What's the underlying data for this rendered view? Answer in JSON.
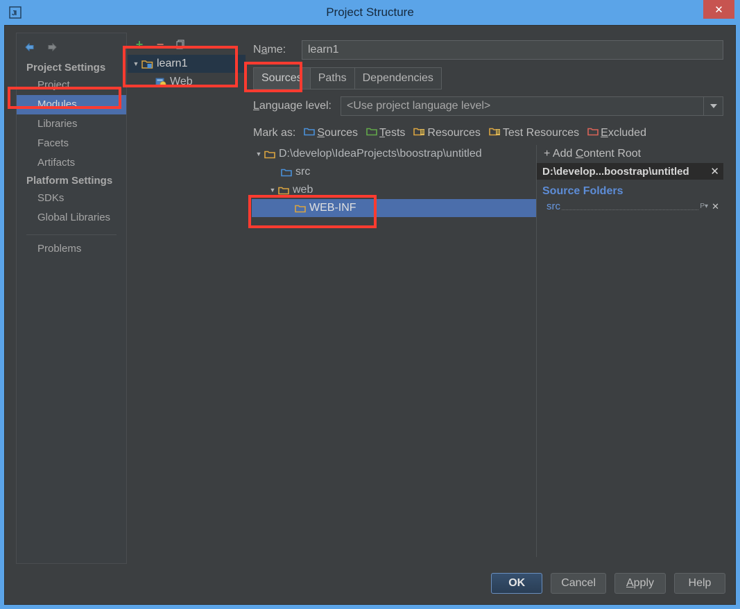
{
  "window": {
    "title": "Project Structure",
    "app_icon": "intellij-idea-icon",
    "close_label": "✕",
    "titlebar_color": "#5BA4E8",
    "close_color": "#C75450"
  },
  "sidebar": {
    "back_label": "◀",
    "forward_label": "▶",
    "groups": [
      {
        "header": "Project Settings",
        "items": [
          "Project",
          "Modules",
          "Libraries",
          "Facets",
          "Artifacts"
        ]
      },
      {
        "header": "Platform Settings",
        "items": [
          "SDKs",
          "Global Libraries"
        ]
      }
    ],
    "extra": [
      "Problems"
    ],
    "selected": "Modules",
    "selection_color": "#4B6EAB"
  },
  "module_panel": {
    "toolbar": {
      "add_label": "+",
      "remove_label": "−",
      "copy_label": "⧉"
    },
    "tree": [
      {
        "label": "learn1",
        "icon": "module-folder-icon",
        "twisty": "▼",
        "indent": 0,
        "selected": true
      },
      {
        "label": "Web",
        "icon": "web-facet-icon",
        "twisty": "",
        "indent": 1,
        "selected": false
      }
    ]
  },
  "main": {
    "name_label": "Name:",
    "name_value": "learn1",
    "tabs": [
      {
        "label": "Sources",
        "active": true
      },
      {
        "label": "Paths",
        "active": false
      },
      {
        "label": "Dependencies",
        "active": false
      }
    ],
    "language_level_label": "Language level:",
    "language_level_value": "<Use project language level>",
    "language_level_arrow": "▼",
    "mark_as_label": "Mark as:",
    "mark_as": [
      {
        "label": "Sources",
        "color": "#4A90D9",
        "icon": "folder-sources-icon"
      },
      {
        "label": "Tests",
        "color": "#62A84A",
        "icon": "folder-tests-icon"
      },
      {
        "label": "Resources",
        "color": "#D9A441",
        "icon": "folder-resources-icon"
      },
      {
        "label": "Test Resources",
        "color": "#D9A441",
        "icon": "folder-test-resources-icon"
      },
      {
        "label": "Excluded",
        "color": "#D96459",
        "icon": "folder-excluded-icon"
      }
    ],
    "tree": [
      {
        "label": "D:\\develop\\IdeaProjects\\boostrap\\untitled",
        "twisty": "▼",
        "indent": 0,
        "color": "#D9A441",
        "selected": false
      },
      {
        "label": "src",
        "twisty": "",
        "indent": 1,
        "color": "#4A90D9",
        "selected": false
      },
      {
        "label": "web",
        "twisty": "▼",
        "indent": 1,
        "color": "#D9A441",
        "selected": false
      },
      {
        "label": "WEB-INF",
        "twisty": "",
        "indent": 2,
        "color": "#D9A441",
        "selected": true
      }
    ],
    "right_panel": {
      "add_content_root": "+ Add Content Root",
      "content_root": "D:\\develop...boostrap\\untitled",
      "content_root_remove": "✕",
      "source_folders_title": "Source Folders",
      "source_folders": [
        {
          "name": "src",
          "prefix_icon": "package-prefix-icon",
          "remove_icon": "✕"
        }
      ]
    }
  },
  "buttons": [
    {
      "label": "OK",
      "default": true
    },
    {
      "label": "Cancel",
      "default": false
    },
    {
      "label": "Apply",
      "default": false
    },
    {
      "label": "Help",
      "default": false
    }
  ],
  "annotations": {
    "color": "#FF3B30",
    "boxes": [
      "modules-sidebar-item",
      "module-tree",
      "sources-tab",
      "web-inf-node"
    ]
  }
}
